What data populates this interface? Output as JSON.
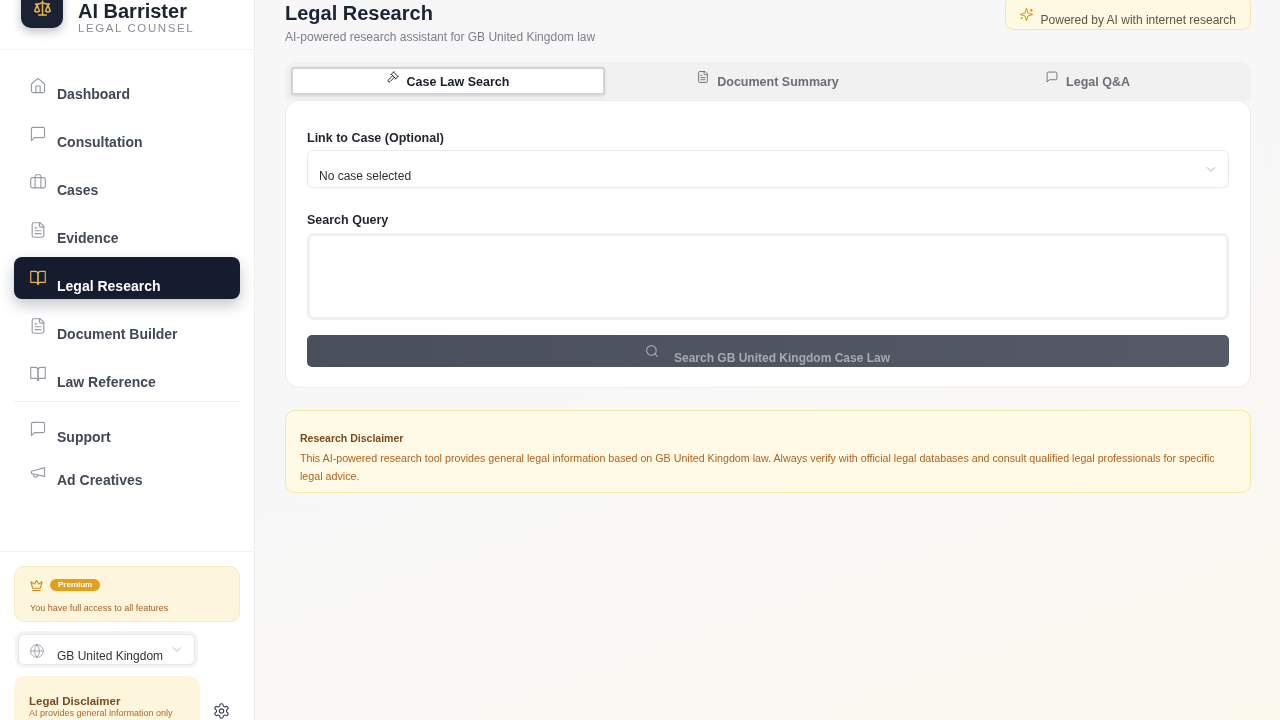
{
  "brand": {
    "title": "AI Barrister",
    "subtitle": "LEGAL COUNSEL"
  },
  "sidebar": {
    "nav": [
      {
        "label": "Dashboard",
        "selected": false
      },
      {
        "label": "Consultation",
        "selected": false
      },
      {
        "label": "Cases",
        "selected": false
      },
      {
        "label": "Evidence",
        "selected": false
      },
      {
        "label": "Legal Research",
        "selected": true
      },
      {
        "label": "Document Builder",
        "selected": false
      },
      {
        "label": "Law Reference",
        "selected": false
      }
    ],
    "secondary": [
      {
        "label": "Support",
        "selected": false
      },
      {
        "label": "Ad Creatives",
        "selected": false
      }
    ]
  },
  "premium": {
    "badge": "Premium",
    "text": "You have full access to all features"
  },
  "country_select": {
    "value": "GB United Kingdom"
  },
  "legal_disclaimer": {
    "title": "Legal Disclaimer",
    "text": "AI provides general information only"
  },
  "header": {
    "title": "Legal Research",
    "subtitle": "AI-powered research assistant for GB United Kingdom law",
    "badge": "Powered by AI with internet research"
  },
  "tabs": [
    {
      "label": "Case Law Search",
      "selected": true
    },
    {
      "label": "Document Summary",
      "selected": false
    },
    {
      "label": "Legal Q&A",
      "selected": false
    }
  ],
  "form": {
    "case_field": {
      "label": "Link to Case (Optional)",
      "value": "No case selected"
    },
    "query_field": {
      "label": "Search Query"
    },
    "search_button": {
      "label": "Search GB United Kingdom Case Law",
      "disabled": true
    }
  },
  "research_disclaimer": {
    "title": "Research Disclaimer",
    "text": "This AI-powered research tool provides general legal information based on GB United Kingdom law. Always verify with official legal databases and consult qualified legal professionals for specific legal advice."
  }
}
